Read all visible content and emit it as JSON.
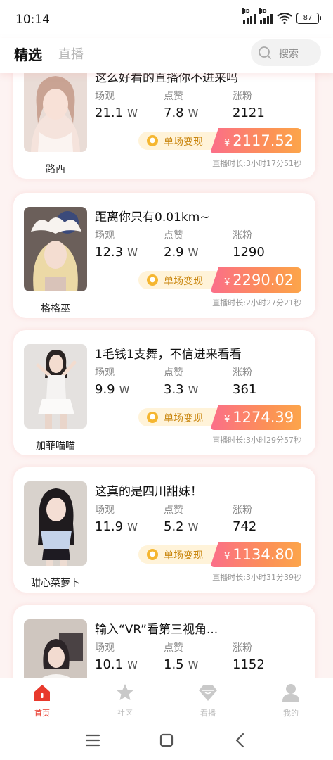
{
  "status_bar": {
    "time": "10:14",
    "signal_1_badge": "HD",
    "signal_2_badge": "HD",
    "battery": "87"
  },
  "header": {
    "tab_active": "精选",
    "tab_inactive": "直播",
    "search_placeholder": "搜索"
  },
  "cards": [
    {
      "name": "路西",
      "title": "这么好看的直播你不进来吗",
      "stats": {
        "views_label": "场观",
        "views": "21.1",
        "views_unit": "W",
        "likes_label": "点赞",
        "likes": "7.8",
        "likes_unit": "W",
        "fans_label": "涨粉",
        "fans": "2121"
      },
      "earn_label": "单场变现",
      "currency": "¥",
      "amount": "2117.52",
      "duration": "直播时长:3小时17分51秒"
    },
    {
      "name": "格格巫",
      "title": "距离你只有0.01km~",
      "stats": {
        "views_label": "场观",
        "views": "12.3",
        "views_unit": "W",
        "likes_label": "点赞",
        "likes": "2.9",
        "likes_unit": "W",
        "fans_label": "涨粉",
        "fans": "1290"
      },
      "earn_label": "单场变现",
      "currency": "¥",
      "amount": "2290.02",
      "duration": "直播时长:2小时27分21秒"
    },
    {
      "name": "加菲喵喵",
      "title": "1毛钱1支舞，不信进来看看",
      "stats": {
        "views_label": "场观",
        "views": "9.9",
        "views_unit": "W",
        "likes_label": "点赞",
        "likes": "3.3",
        "likes_unit": "W",
        "fans_label": "涨粉",
        "fans": "361"
      },
      "earn_label": "单场变现",
      "currency": "¥",
      "amount": "1274.39",
      "duration": "直播时长:3小时29分57秒"
    },
    {
      "name": "甜心菜萝卜",
      "title": "这真的是四川甜妹！",
      "stats": {
        "views_label": "场观",
        "views": "11.9",
        "views_unit": "W",
        "likes_label": "点赞",
        "likes": "5.2",
        "likes_unit": "W",
        "fans_label": "涨粉",
        "fans": "742"
      },
      "earn_label": "单场变现",
      "currency": "¥",
      "amount": "1134.80",
      "duration": "直播时长:3小时31分39秒"
    },
    {
      "name": "",
      "title": "输入“VR”看第三视角...",
      "stats": {
        "views_label": "场观",
        "views": "10.1",
        "views_unit": "W",
        "likes_label": "点赞",
        "likes": "1.5",
        "likes_unit": "W",
        "fans_label": "涨粉",
        "fans": "1152"
      },
      "earn_label": "",
      "currency": "",
      "amount": "",
      "duration": ""
    }
  ],
  "bottom_nav": [
    {
      "label": "首页",
      "icon": "home-icon",
      "active": true
    },
    {
      "label": "社区",
      "icon": "star-icon",
      "active": false
    },
    {
      "label": "看播",
      "icon": "diamond-icon",
      "active": false
    },
    {
      "label": "我的",
      "icon": "person-icon",
      "active": false
    }
  ],
  "colors": {
    "accent": "#e8392c",
    "earn_gradient_start": "#fb6e8a",
    "earn_gradient_end": "#fca54a",
    "earn_label_bg": "#fff3d9",
    "page_bg": "#fdf3f2"
  }
}
